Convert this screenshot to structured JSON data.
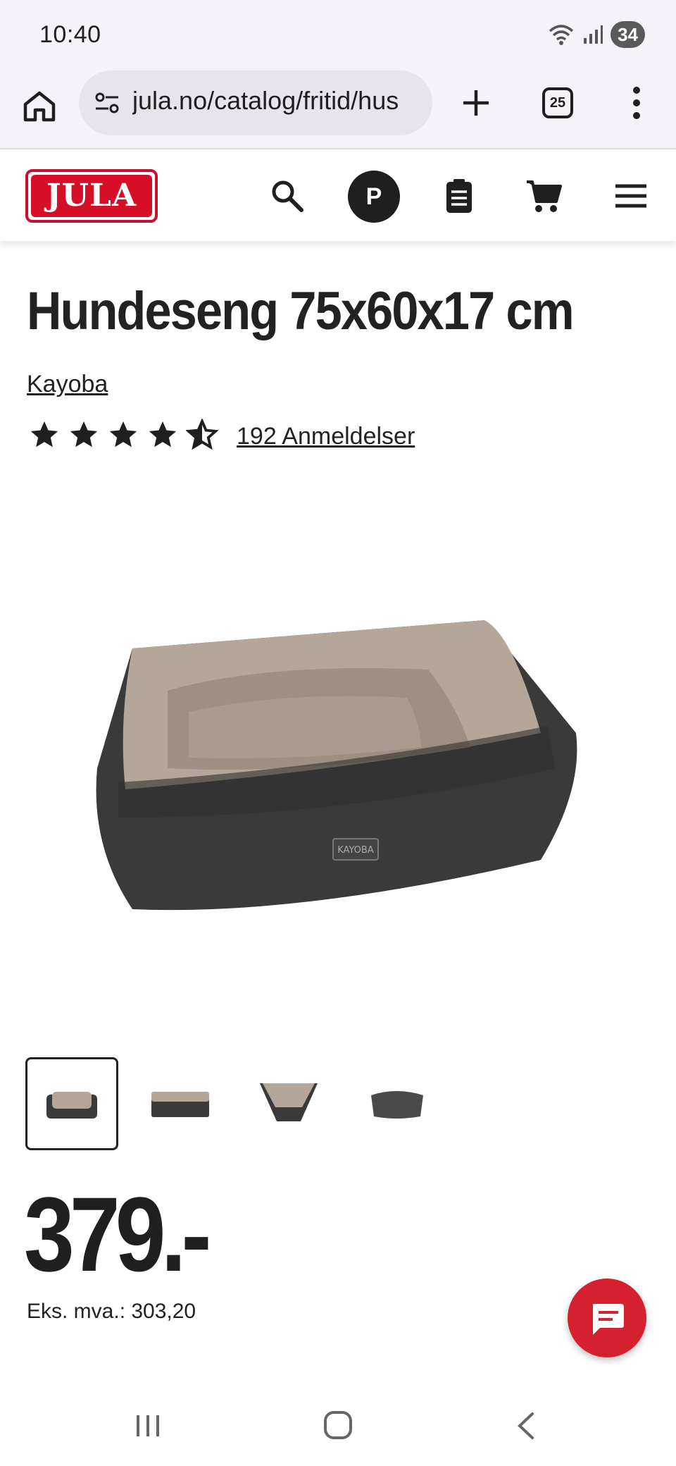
{
  "status_bar": {
    "time": "10:40",
    "battery": "34"
  },
  "browser": {
    "url": "jula.no/catalog/fritid/hus",
    "tab_count": "25"
  },
  "site": {
    "logo_text": "JULA",
    "avatar_initial": "P"
  },
  "product": {
    "title": "Hundeseng 75x60x17 cm",
    "brand": "Kayoba",
    "rating": 4.5,
    "rating_max": 5,
    "reviews_label": "192 Anmeldelser",
    "image_label": "KAYOBA",
    "thumbnail_count": 4,
    "price": "379.-",
    "vat_label": "Eks. mva.: 303,20"
  },
  "colors": {
    "brand_red": "#d50f25",
    "chat_red": "#d6202f",
    "text": "#1f1f1f"
  }
}
